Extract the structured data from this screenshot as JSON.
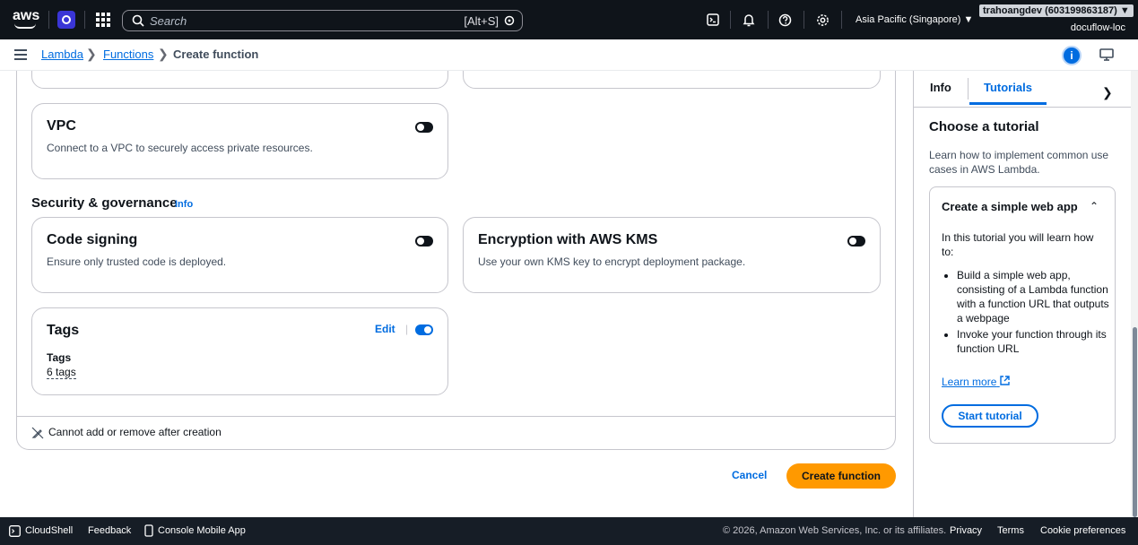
{
  "topbar": {
    "logo_text": "aws",
    "search_placeholder": "Search",
    "search_shortcut": "[Alt+S]",
    "region": "Asia Pacific (Singapore) ▼",
    "account_id": "trahoangdev (603199863187) ▼",
    "account_alias": "docuflow-loc"
  },
  "breadcrumb": {
    "items": [
      "Lambda",
      "Functions",
      "Create function"
    ]
  },
  "form": {
    "vpc": {
      "title": "VPC",
      "desc": "Connect to a VPC to securely access private resources."
    },
    "security_heading": "Security & governance",
    "security_info": "Info",
    "code_signing": {
      "title": "Code signing",
      "desc": "Ensure only trusted code is deployed."
    },
    "encryption": {
      "title": "Encryption with AWS KMS",
      "desc": "Use your own KMS key to encrypt deployment package."
    },
    "tags": {
      "title": "Tags",
      "edit": "Edit",
      "label": "Tags",
      "value": "6 tags"
    },
    "note": "Cannot add or remove after creation",
    "cancel": "Cancel",
    "create": "Create function"
  },
  "side_panel": {
    "tabs": [
      "Info",
      "Tutorials"
    ],
    "active_tab": "Tutorials",
    "heading": "Choose a tutorial",
    "intro": "Learn how to implement common use cases in AWS Lambda.",
    "tutorial": {
      "title": "Create a simple web app",
      "desc": "In this tutorial you will learn how to:",
      "bullets": [
        "Build a simple web app, consisting of a Lambda function with a function URL that outputs a webpage",
        "Invoke your function through its function URL"
      ],
      "learn_more": "Learn more",
      "start": "Start tutorial"
    }
  },
  "footer": {
    "cloudshell": "CloudShell",
    "feedback": "Feedback",
    "mobile": "Console Mobile App",
    "copyright": "© 2026, Amazon Web Services, Inc. or its affiliates.",
    "privacy": "Privacy",
    "terms": "Terms",
    "cookies": "Cookie preferences"
  },
  "colors": {
    "accent": "#006ce0",
    "cta": "#ff9900",
    "topbar": "#0f141a"
  }
}
